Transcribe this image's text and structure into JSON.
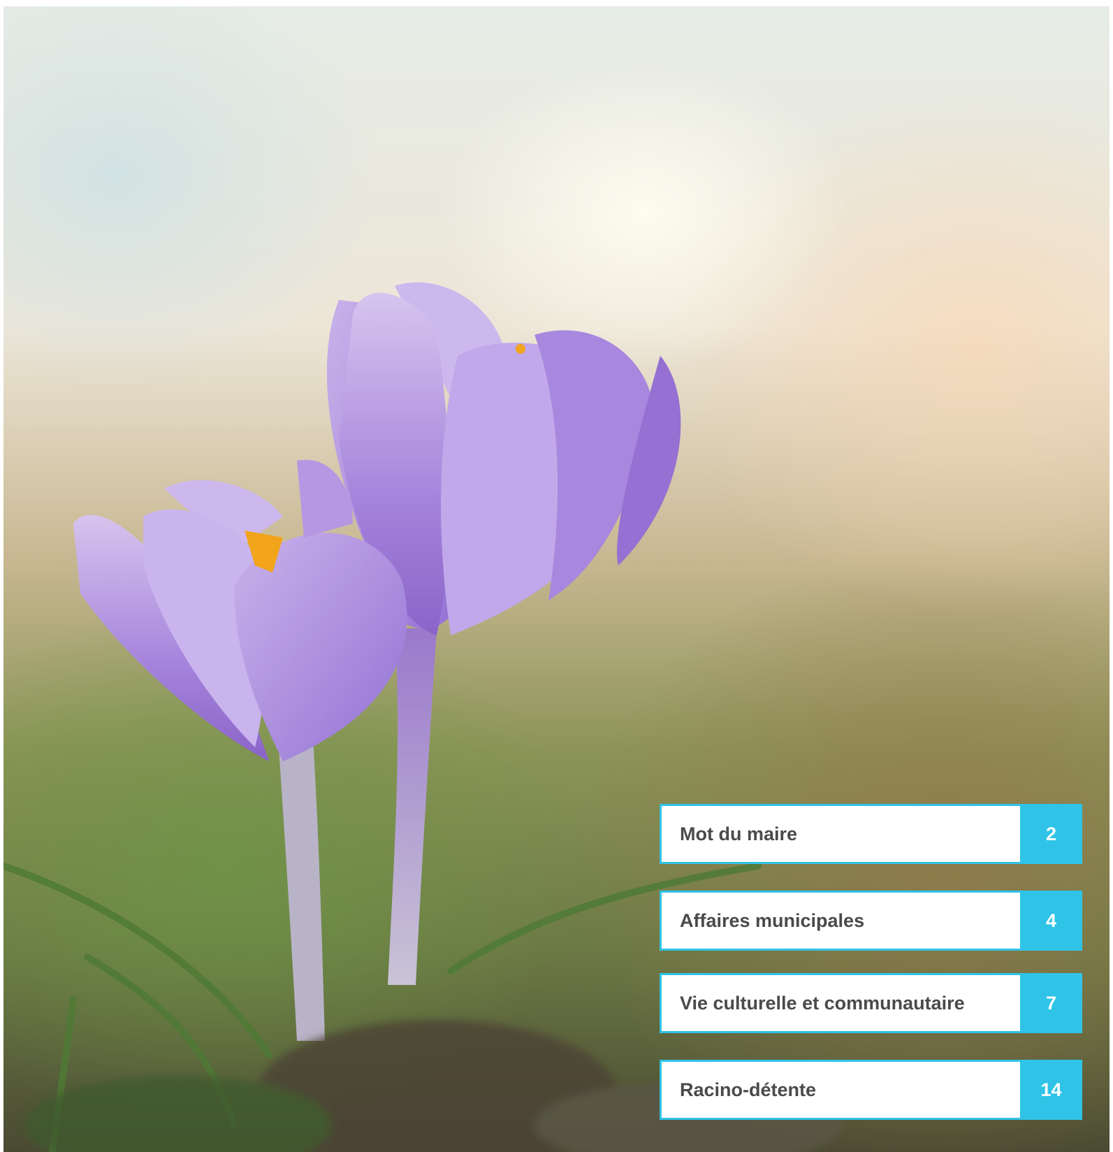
{
  "photo": {
    "subject-icon": "crocus-flower-photo"
  },
  "toc": {
    "items": [
      {
        "title": "Mot du maire",
        "page": "2"
      },
      {
        "title": "Affaires municipales",
        "page": "4"
      },
      {
        "title": "Vie culturelle et communautaire",
        "page": "7"
      },
      {
        "title": "Racino-détente",
        "page": "14"
      }
    ]
  },
  "colors": {
    "accent": "#2fc3e8",
    "text": "#4a4a4a"
  }
}
